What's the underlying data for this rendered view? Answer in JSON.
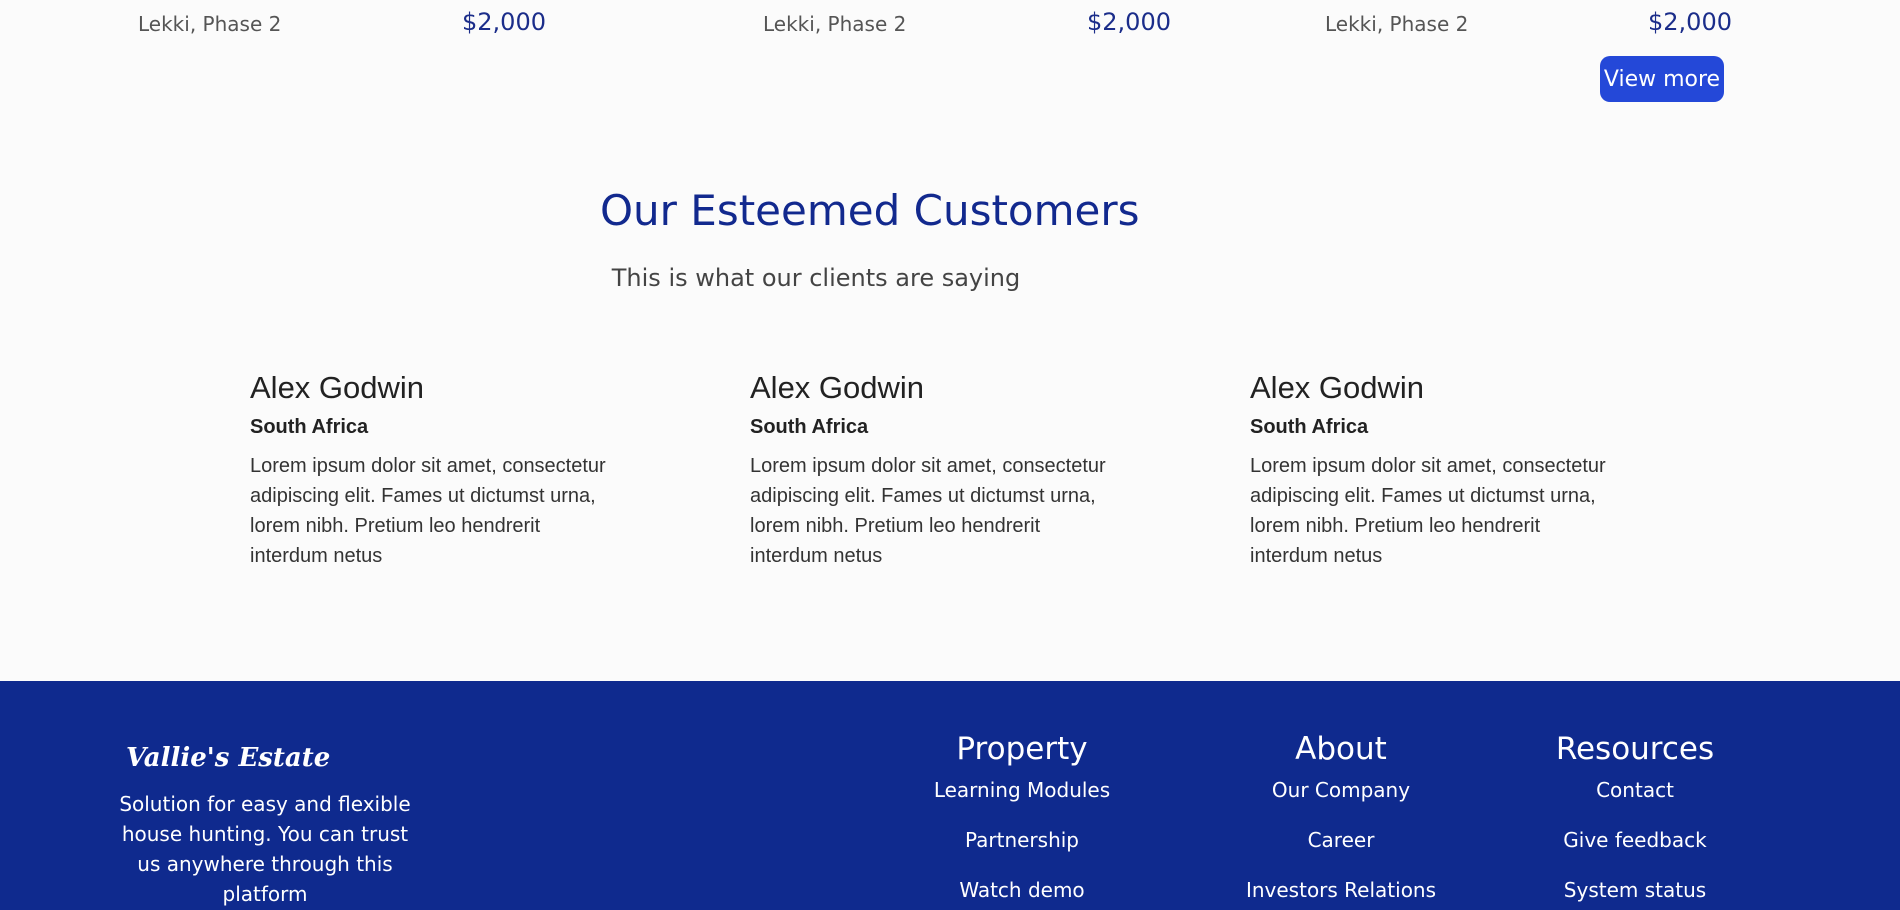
{
  "listings": [
    {
      "location": "Lekki, Phase 2",
      "price": "$2,000"
    },
    {
      "location": "Lekki, Phase 2",
      "price": "$2,000"
    },
    {
      "location": "Lekki, Phase 2",
      "price": "$2,000"
    }
  ],
  "view_more_label": "View more",
  "customers": {
    "title": "Our Esteemed Customers",
    "subtitle": "This is what our clients are saying",
    "testimonials": [
      {
        "name": "Alex Godwin",
        "country": "South Africa",
        "text": "Lorem ipsum dolor sit amet, consectetur adipiscing elit. Fames ut dictumst urna, lorem nibh. Pretium leo hendrerit interdum netus"
      },
      {
        "name": "Alex Godwin",
        "country": "South Africa",
        "text": "Lorem ipsum dolor sit amet, consectetur adipiscing elit. Fames ut dictumst urna, lorem nibh. Pretium leo hendrerit interdum netus"
      },
      {
        "name": "Alex Godwin",
        "country": "South Africa",
        "text": "Lorem ipsum dolor sit amet, consectetur adipiscing elit. Fames ut dictumst urna, lorem nibh. Pretium leo hendrerit interdum netus"
      }
    ]
  },
  "footer": {
    "brand": "Vallie's Estate",
    "tagline": "Solution for easy and flexible house hunting. You can trust us anywhere through this platform",
    "columns": [
      {
        "title": "Property",
        "links": [
          "Learning Modules",
          "Partnership",
          "Watch demo"
        ]
      },
      {
        "title": "About",
        "links": [
          "Our Company",
          "Career",
          "Investors Relations"
        ]
      },
      {
        "title": "Resources",
        "links": [
          "Contact",
          "Give feedback",
          "System status"
        ]
      }
    ]
  },
  "colors": {
    "brand_navy": "#0f2a8e",
    "button_blue": "#2448d8",
    "title_blue": "#12298e",
    "background": "#fbfbfb"
  }
}
